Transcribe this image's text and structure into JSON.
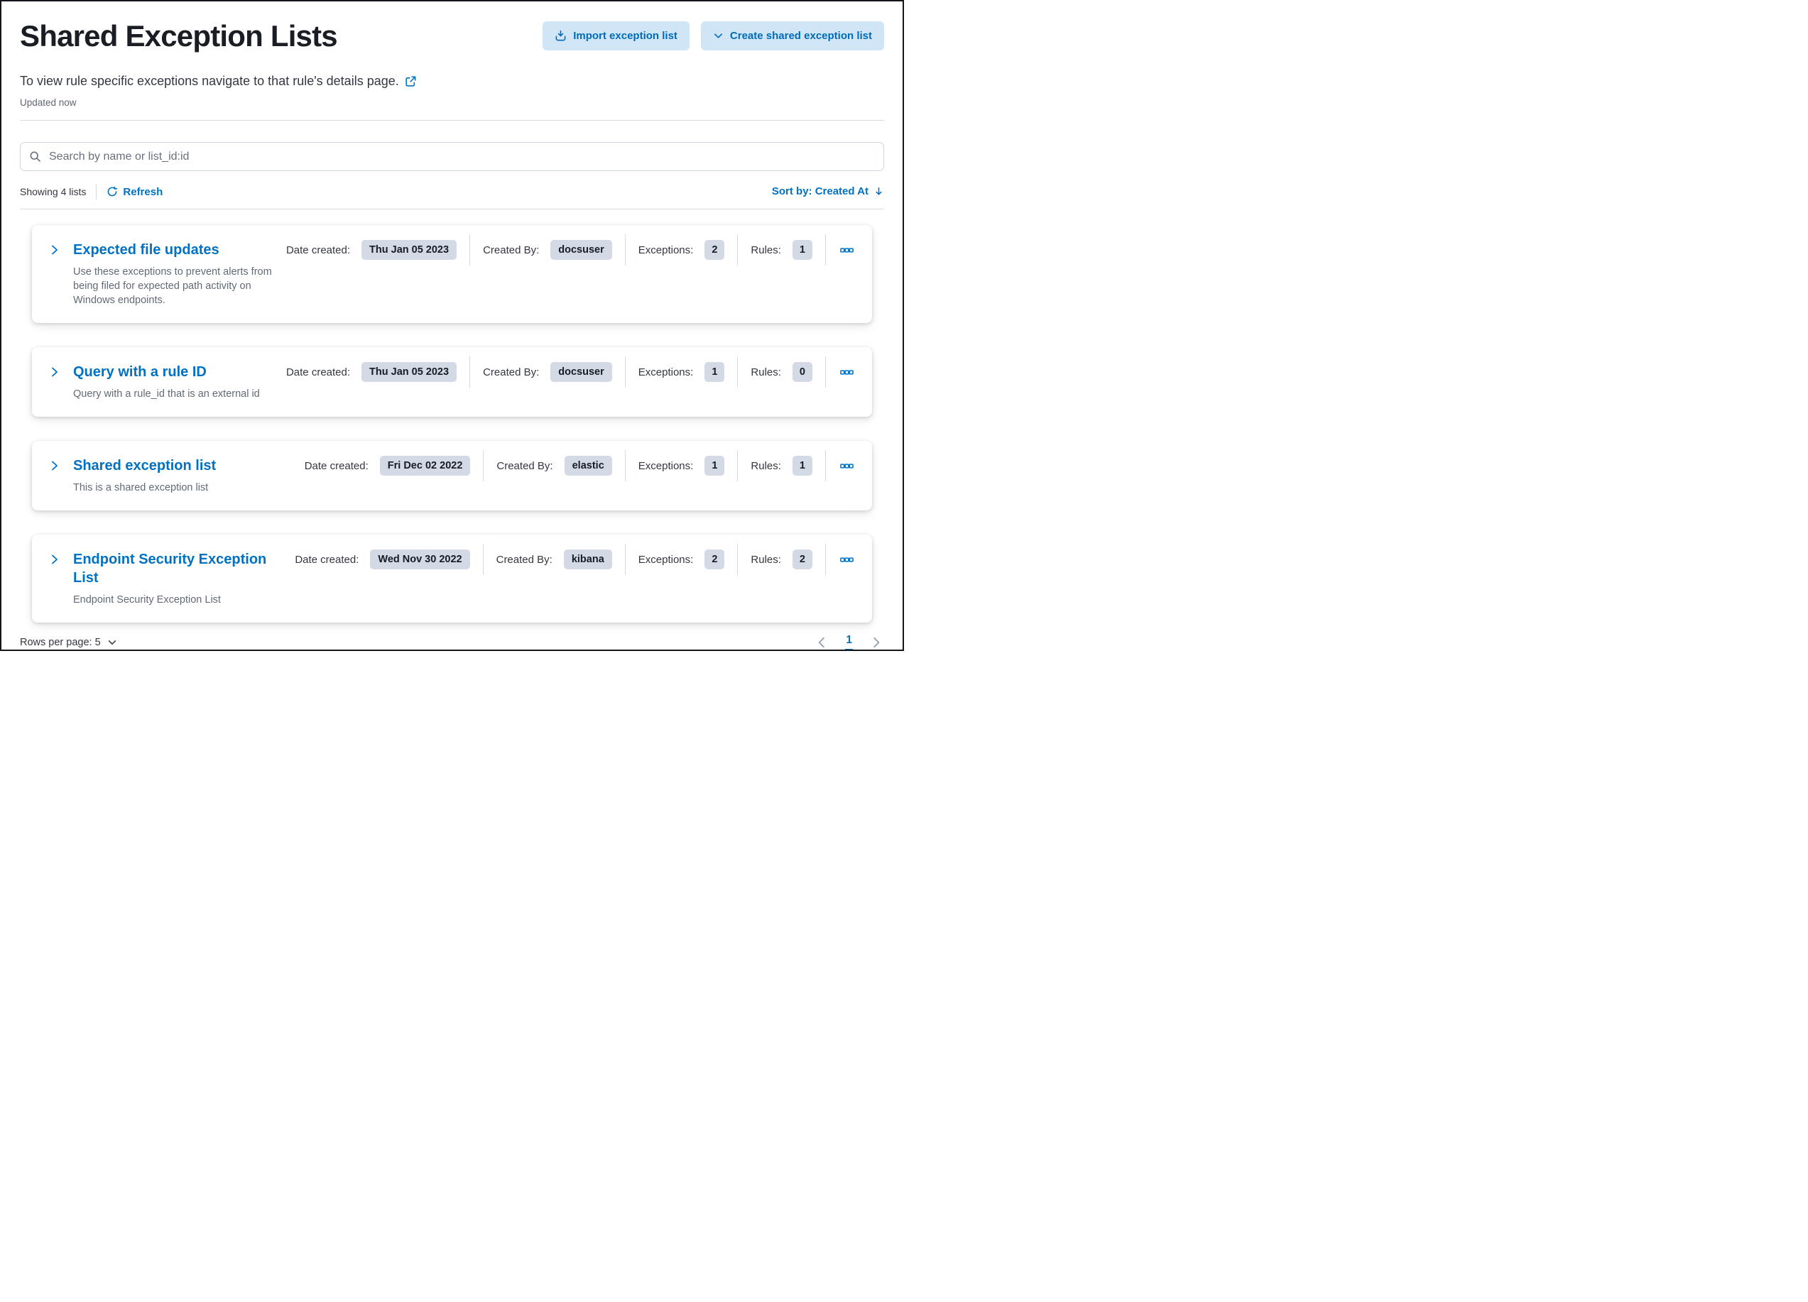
{
  "page": {
    "title": "Shared Exception Lists",
    "subtitle": "To view rule specific exceptions navigate to that rule's details page.",
    "updated": "Updated now"
  },
  "actions": {
    "import_label": "Import exception list",
    "create_label": "Create shared exception list"
  },
  "search": {
    "placeholder": "Search by name or list_id:id",
    "value": ""
  },
  "toolbar": {
    "showing": "Showing 4 lists",
    "refresh_label": "Refresh",
    "sort_label": "Sort by: Created At"
  },
  "labels": {
    "date_created": "Date created:",
    "created_by": "Created By:",
    "exceptions": "Exceptions:",
    "rules": "Rules:"
  },
  "lists": [
    {
      "title": "Expected file updates",
      "description": "Use these exceptions to prevent alerts from being filed for expected path activity on Windows endpoints.",
      "date_created": "Thu Jan 05 2023",
      "created_by": "docsuser",
      "exceptions": "2",
      "rules": "1"
    },
    {
      "title": "Query with a rule ID",
      "description": "Query with a rule_id that is an external id",
      "date_created": "Thu Jan 05 2023",
      "created_by": "docsuser",
      "exceptions": "1",
      "rules": "0"
    },
    {
      "title": "Shared exception list",
      "description": "This is a shared exception list",
      "date_created": "Fri Dec 02 2022",
      "created_by": "elastic",
      "exceptions": "1",
      "rules": "1"
    },
    {
      "title": "Endpoint Security Exception List",
      "description": "Endpoint Security Exception List",
      "date_created": "Wed Nov 30 2022",
      "created_by": "kibana",
      "exceptions": "2",
      "rules": "2"
    }
  ],
  "footer": {
    "rows_per_page": "Rows per page: 5",
    "page_number": "1"
  },
  "colors": {
    "primary_link": "#0071c3",
    "button_bg": "#d0e6f7",
    "button_text": "#006bb8",
    "badge_bg": "#d3dae6",
    "text": "#343741",
    "subdued": "#69707d",
    "divider": "#d3dae6"
  }
}
